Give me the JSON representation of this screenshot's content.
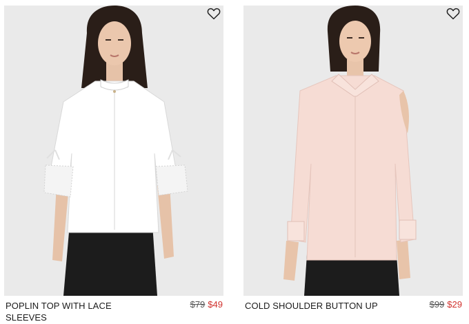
{
  "products": [
    {
      "name": "POPLIN TOP WITH LACE SLEEVES",
      "original_price": "$79",
      "sale_price": "$49",
      "wishlist_icon": "heart-outline-icon",
      "shirt_color": "#ffffff"
    },
    {
      "name": "COLD SHOULDER BUTTON UP",
      "original_price": "$99",
      "sale_price": "$29",
      "wishlist_icon": "heart-outline-icon",
      "shirt_color": "#f6dcd4"
    }
  ],
  "colors": {
    "sale": "#d0312d",
    "photo_background": "#eaeaea"
  }
}
